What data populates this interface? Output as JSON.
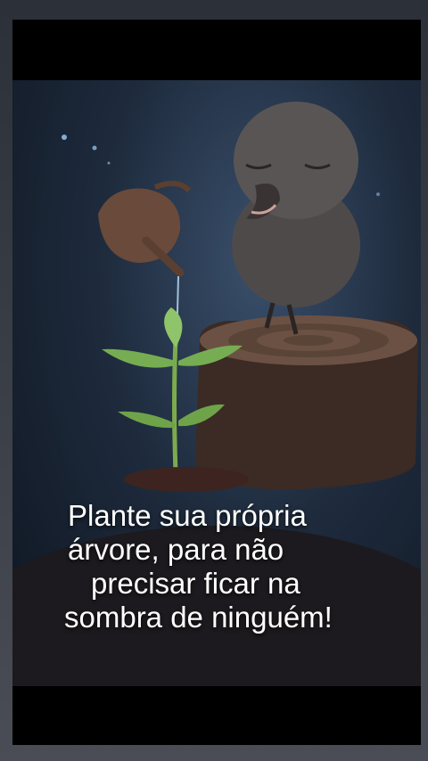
{
  "caption": {
    "line1": "Plante sua própria",
    "line2": "árvore, para não",
    "line3": "precisar ficar na",
    "line4": "sombra de ninguém!"
  }
}
